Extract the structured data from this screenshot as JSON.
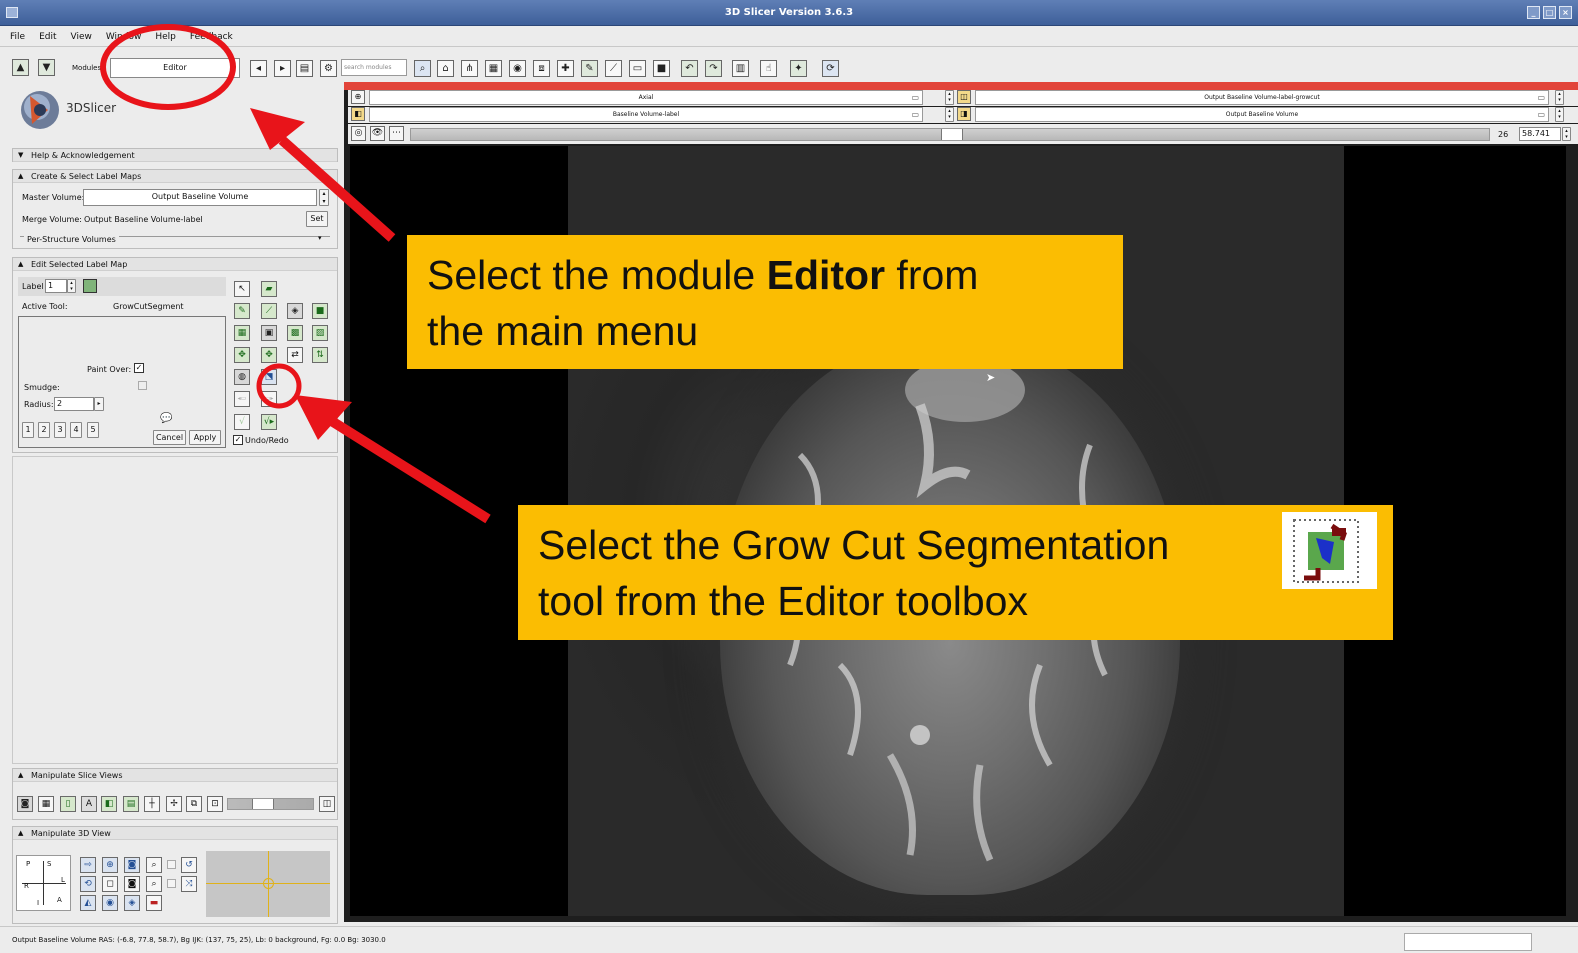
{
  "window": {
    "title": "3D Slicer Version 3.6.3"
  },
  "menu": [
    "File",
    "Edit",
    "View",
    "Window",
    "Help",
    "Feedback"
  ],
  "toolbar": {
    "modules_label": "Modules:",
    "module_selected": "Editor",
    "search_placeholder": "search modules"
  },
  "logo": {
    "text": "3DSlicer"
  },
  "panels": {
    "help": {
      "title": "Help & Acknowledgement"
    },
    "create": {
      "title": "Create & Select Label Maps",
      "master_label": "Master Volume:",
      "master_value": "Output Baseline Volume",
      "merge_label": "Merge Volume:",
      "merge_value": "Output Baseline Volume-label",
      "set_button": "Set",
      "per_structure": "Per-Structure Volumes"
    },
    "edit": {
      "title": "Edit Selected Label Map",
      "label_label": "Label",
      "label_value": "1",
      "active_tool_label": "Active Tool:",
      "active_tool_value": "GrowCutSegment",
      "paint_over_label": "Paint Over:",
      "smudge_label": "Smudge:",
      "radius_label": "Radius:",
      "radius_value": "2",
      "radius_presets": [
        "1",
        "2",
        "3",
        "4",
        "5"
      ],
      "cancel_button": "Cancel",
      "apply_button": "Apply",
      "undo_redo_label": "Undo/Redo"
    },
    "slice_views": {
      "title": "Manipulate Slice Views"
    },
    "view3d": {
      "title": "Manipulate 3D View",
      "orientation_letters": {
        "P": "P",
        "S": "S",
        "R": "R",
        "L": "L",
        "I": "I",
        "A": "A"
      }
    }
  },
  "viewer": {
    "orientation": "Axial",
    "foreground": "Output Baseline Volume-label-growcut",
    "label_layer": "Baseline Volume-label",
    "background": "Output Baseline Volume",
    "slice_index": "26",
    "slice_offset": "58.741"
  },
  "callouts": {
    "editor": {
      "before": "Select the module ",
      "bold": "Editor",
      "after": " from",
      "line2": "the main menu"
    },
    "growcut": {
      "line1": "Select the Grow Cut Segmentation",
      "line2": "tool from the Editor toolbox"
    }
  },
  "status": {
    "text": "Output Baseline Volume RAS: (-6.8, 77.8, 58.7), Bg IJK: (137, 75, 25), Lb: 0 background, Fg: 0.0 Bg: 3030.0"
  },
  "colors": {
    "callout": "#fbbd02",
    "annotation_red": "#e8141a",
    "slice_red_bar": "#e2443a"
  }
}
